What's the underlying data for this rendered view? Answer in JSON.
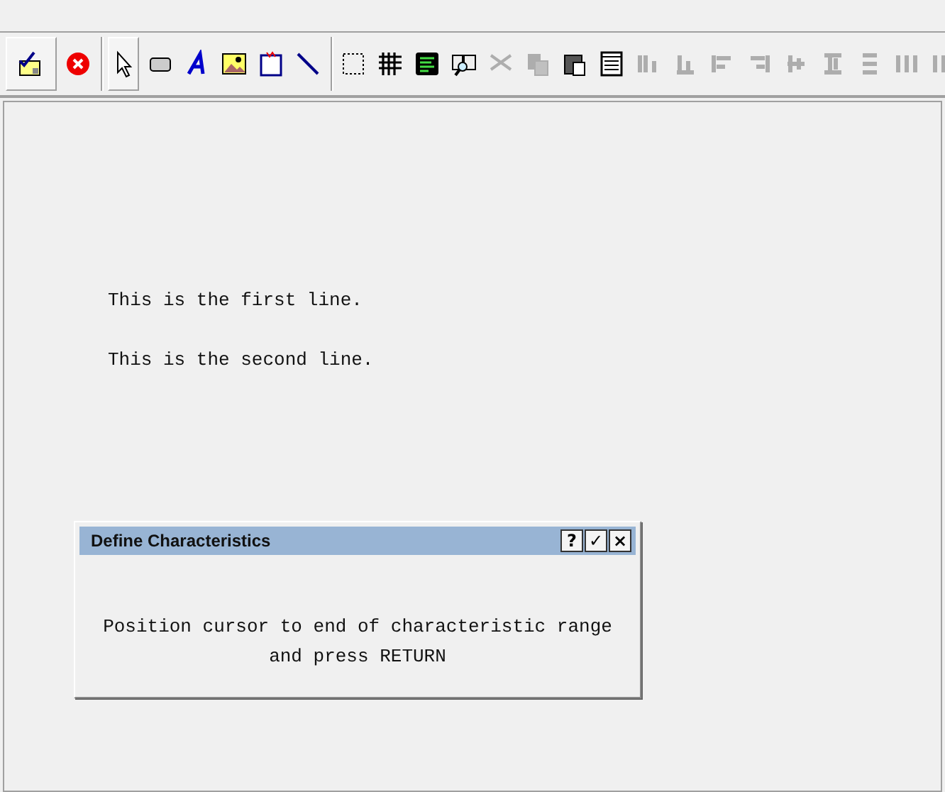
{
  "toolbar": [
    [
      {
        "selected": true,
        "disabled": false
      },
      {
        "selected": false,
        "disabled": false
      }
    ],
    [
      {
        "selected": true,
        "disabled": false
      },
      {
        "selected": false,
        "disabled": false
      },
      {
        "selected": false,
        "disabled": false
      },
      {
        "selected": false,
        "disabled": false
      },
      {
        "selected": false,
        "disabled": false
      },
      {
        "selected": false,
        "disabled": false
      }
    ],
    [
      {
        "selected": false,
        "disabled": false
      },
      {
        "selected": false,
        "disabled": false
      },
      {
        "selected": false,
        "disabled": false
      },
      {
        "selected": false,
        "disabled": false
      },
      {
        "selected": false,
        "disabled": true
      },
      {
        "selected": false,
        "disabled": true
      },
      {
        "selected": false,
        "disabled": false
      },
      {
        "selected": false,
        "disabled": false
      },
      {
        "selected": false,
        "disabled": true
      },
      {
        "selected": false,
        "disabled": true
      },
      {
        "selected": false,
        "disabled": true
      },
      {
        "selected": false,
        "disabled": true
      },
      {
        "selected": false,
        "disabled": true
      },
      {
        "selected": false,
        "disabled": true
      },
      {
        "selected": false,
        "disabled": true
      },
      {
        "selected": false,
        "disabled": true
      },
      {
        "selected": false,
        "disabled": true
      }
    ]
  ],
  "document": {
    "lines": [
      "This is the first line.",
      "This is the second line."
    ]
  },
  "dialog": {
    "title": "Define Characteristics",
    "buttons": [
      "?",
      "✓",
      "×"
    ],
    "message": [
      "Position cursor to end of characteristic range",
      "and press RETURN"
    ]
  }
}
